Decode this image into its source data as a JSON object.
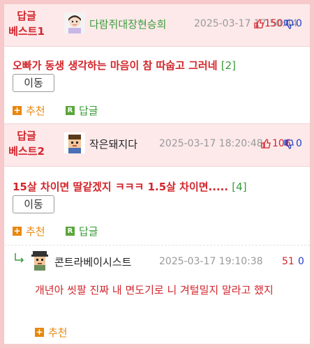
{
  "comments": [
    {
      "best_label": "답글\n베스트1",
      "nickname": "다람쥐대장현승희",
      "date": "2025-03-17 17:50:44",
      "upvotes": "150",
      "downvotes": "0",
      "body": "오빠가 동생 생각하는 마음이 참 따숩고 그러네",
      "reply_count": "[2]",
      "move_label": "이동",
      "recommend_label": "추천",
      "reply_label": "답글"
    },
    {
      "best_label": "답글\n베스트2",
      "nickname": "작은돼지다",
      "date": "2025-03-17 18:20:48",
      "upvotes": "106",
      "downvotes": "0",
      "body": "15살 차이면 딸같겠지 ㅋㅋㅋ 1.5살 차이면.....",
      "reply_count": "[4]",
      "move_label": "이동",
      "recommend_label": "추천",
      "reply_label": "답글"
    }
  ],
  "reply": {
    "nickname": "콘트라베이시스트",
    "date": "2025-03-17 19:10:38",
    "upvotes": "51",
    "downvotes": "0",
    "body": "개년아 씻팔 진짜 내 면도기로 니 겨털밀지 말라고 했지",
    "recommend_label": "추천"
  },
  "colors": {
    "best_bg": "#fde9ea",
    "best_text": "#d2252b",
    "nick_green": "#3a9b3a",
    "recommend_orange": "#e8870e",
    "reply_green": "#5aa63a",
    "down_blue": "#2540c4"
  },
  "icons": [
    "thumbs-up-icon",
    "thumbs-down-icon",
    "plus-icon",
    "reply-icon",
    "reply-arrow-icon",
    "avatar-icon"
  ]
}
